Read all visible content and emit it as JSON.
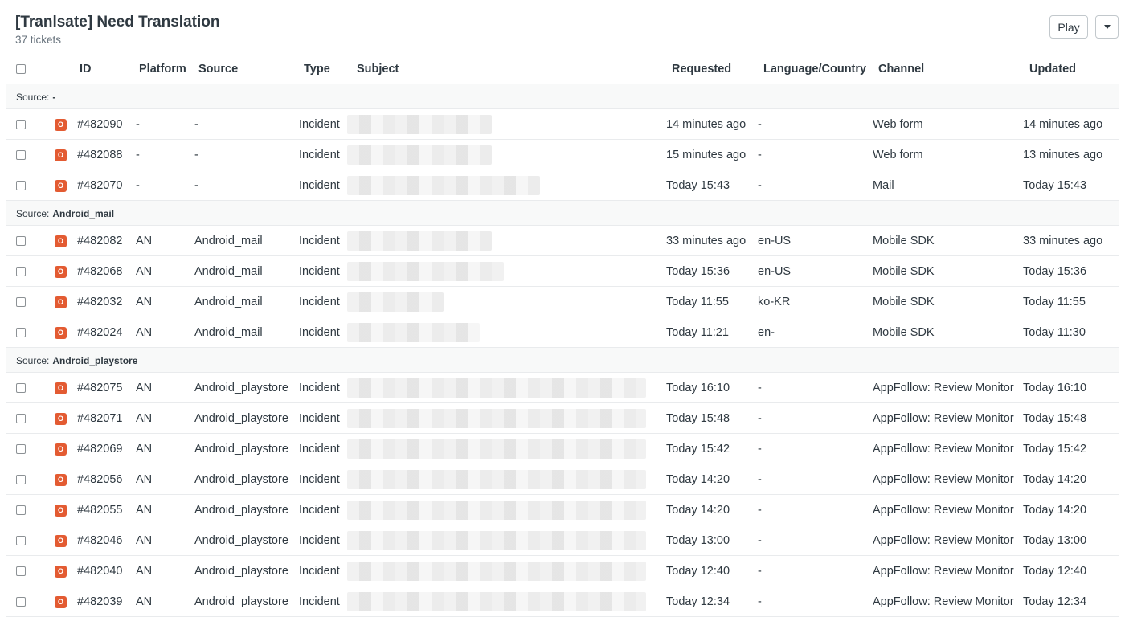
{
  "header": {
    "title": "[Tranlsate] Need Translation",
    "subtitle": "37 tickets"
  },
  "actions": {
    "play_label": "Play"
  },
  "columns": {
    "id": "ID",
    "platform": "Platform",
    "source": "Source",
    "type": "Type",
    "subject": "Subject",
    "requested": "Requested",
    "lang": "Language/Country",
    "channel": "Channel",
    "updated": "Updated"
  },
  "status_letter": "O",
  "source_prefix": "Source:",
  "groups": [
    {
      "source": "-",
      "tickets": [
        {
          "id": "#482090",
          "platform": "-",
          "source": "-",
          "type": "Incident",
          "requested": "14 minutes ago",
          "lang": "-",
          "channel": "Web form",
          "updated": "14 minutes ago",
          "subject_width": 180
        },
        {
          "id": "#482088",
          "platform": "-",
          "source": "-",
          "type": "Incident",
          "requested": "15 minutes ago",
          "lang": "-",
          "channel": "Web form",
          "updated": "13 minutes ago",
          "subject_width": 180
        },
        {
          "id": "#482070",
          "platform": "-",
          "source": "-",
          "type": "Incident",
          "requested": "Today 15:43",
          "lang": "-",
          "channel": "Mail",
          "updated": "Today 15:43",
          "subject_width": 240
        }
      ]
    },
    {
      "source": "Android_mail",
      "tickets": [
        {
          "id": "#482082",
          "platform": "AN",
          "source": "Android_mail",
          "type": "Incident",
          "requested": "33 minutes ago",
          "lang": "en-US",
          "channel": "Mobile SDK",
          "updated": "33 minutes ago",
          "subject_width": 180
        },
        {
          "id": "#482068",
          "platform": "AN",
          "source": "Android_mail",
          "type": "Incident",
          "requested": "Today 15:36",
          "lang": "en-US",
          "channel": "Mobile SDK",
          "updated": "Today 15:36",
          "subject_width": 195
        },
        {
          "id": "#482032",
          "platform": "AN",
          "source": "Android_mail",
          "type": "Incident",
          "requested": "Today 11:55",
          "lang": "ko-KR",
          "channel": "Mobile SDK",
          "updated": "Today 11:55",
          "subject_width": 120
        },
        {
          "id": "#482024",
          "platform": "AN",
          "source": "Android_mail",
          "type": "Incident",
          "requested": "Today 11:21",
          "lang": "en-",
          "channel": "Mobile SDK",
          "updated": "Today 11:30",
          "subject_width": 165
        }
      ]
    },
    {
      "source": "Android_playstore",
      "tickets": [
        {
          "id": "#482075",
          "platform": "AN",
          "source": "Android_playstore",
          "type": "Incident",
          "requested": "Today 16:10",
          "lang": "-",
          "channel": "AppFollow: Review Monitor",
          "updated": "Today 16:10",
          "subject_width": 372
        },
        {
          "id": "#482071",
          "platform": "AN",
          "source": "Android_playstore",
          "type": "Incident",
          "requested": "Today 15:48",
          "lang": "-",
          "channel": "AppFollow: Review Monitor",
          "updated": "Today 15:48",
          "subject_width": 372
        },
        {
          "id": "#482069",
          "platform": "AN",
          "source": "Android_playstore",
          "type": "Incident",
          "requested": "Today 15:42",
          "lang": "-",
          "channel": "AppFollow: Review Monitor",
          "updated": "Today 15:42",
          "subject_width": 372
        },
        {
          "id": "#482056",
          "platform": "AN",
          "source": "Android_playstore",
          "type": "Incident",
          "requested": "Today 14:20",
          "lang": "-",
          "channel": "AppFollow: Review Monitor",
          "updated": "Today 14:20",
          "subject_width": 372
        },
        {
          "id": "#482055",
          "platform": "AN",
          "source": "Android_playstore",
          "type": "Incident",
          "requested": "Today 14:20",
          "lang": "-",
          "channel": "AppFollow: Review Monitor",
          "updated": "Today 14:20",
          "subject_width": 372
        },
        {
          "id": "#482046",
          "platform": "AN",
          "source": "Android_playstore",
          "type": "Incident",
          "requested": "Today 13:00",
          "lang": "-",
          "channel": "AppFollow: Review Monitor",
          "updated": "Today 13:00",
          "subject_width": 372
        },
        {
          "id": "#482040",
          "platform": "AN",
          "source": "Android_playstore",
          "type": "Incident",
          "requested": "Today 12:40",
          "lang": "-",
          "channel": "AppFollow: Review Monitor",
          "updated": "Today 12:40",
          "subject_width": 372
        },
        {
          "id": "#482039",
          "platform": "AN",
          "source": "Android_playstore",
          "type": "Incident",
          "requested": "Today 12:34",
          "lang": "-",
          "channel": "AppFollow: Review Monitor",
          "updated": "Today 12:34",
          "subject_width": 372
        }
      ]
    }
  ]
}
